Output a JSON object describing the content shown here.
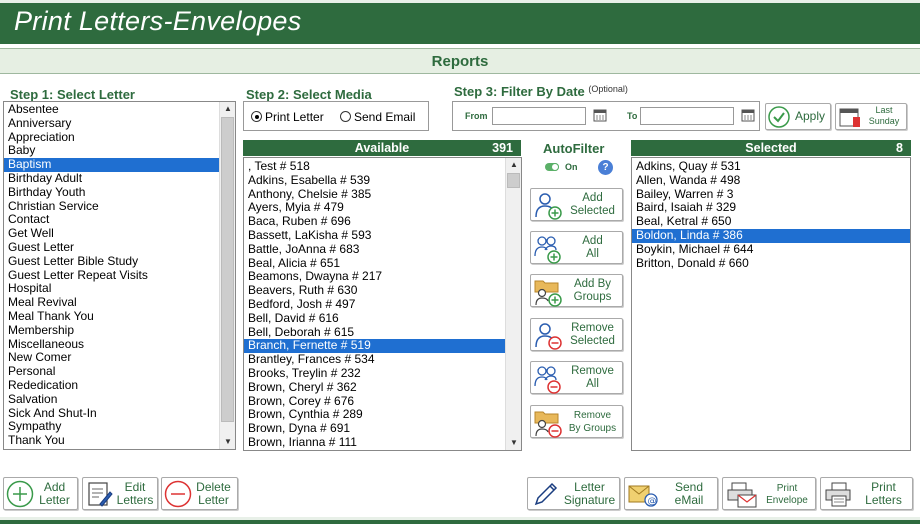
{
  "app": {
    "title": "Print Letters-Envelopes",
    "section": "Reports"
  },
  "steps": {
    "step1": "Step 1: Select Letter",
    "step2": "Step 2: Select Media",
    "step3": "Step 3: Filter By Date",
    "step3_optional": "(Optional)"
  },
  "letters": [
    "Absentee",
    "Anniversary",
    "Appreciation",
    "Baby",
    "Baptism",
    "Birthday Adult",
    "Birthday Youth",
    "Christian Service",
    "Contact",
    "Get Well",
    "Guest Letter",
    "Guest Letter Bible Study",
    "Guest Letter Repeat Visits",
    "Hospital",
    "Meal Revival",
    "Meal Thank You",
    "Membership",
    "Miscellaneous",
    "New Comer",
    "Personal",
    "Rededication",
    "Salvation",
    "Sick And Shut-In",
    "Sympathy",
    "Thank You"
  ],
  "selected_letter": "Baptism",
  "media": {
    "print_letter": "Print Letter",
    "send_email": "Send Email",
    "selected": "print_letter"
  },
  "filter": {
    "from_label": "From",
    "to_label": "To",
    "from_value": "",
    "to_value": "",
    "apply_label": "Apply",
    "last_sunday_line1": "Last",
    "last_sunday_line2": "Sunday"
  },
  "available": {
    "header": "Available",
    "count": "391",
    "items": [
      ", Test # 518",
      "Adkins, Esabella # 539",
      "Anthony, Chelsie # 385",
      "Ayers, Myia # 479",
      "Baca, Ruben # 696",
      "Bassett, LaKisha # 593",
      "Battle, JoAnna # 683",
      "Beal, Alicia # 651",
      "Beamons, Dwayna # 217",
      "Beavers, Ruth # 630",
      "Bedford, Josh # 497",
      "Bell, David # 616",
      "Bell, Deborah # 615",
      "Branch, Fernette # 519",
      "Brantley, Frances # 534",
      "Brooks, Treylin # 232",
      "Brown, Cheryl # 362",
      "Brown, Corey # 676",
      "Brown, Cynthia # 289",
      "Brown, Dyna # 691",
      "Brown, Irianna # 111"
    ],
    "selected_item": "Branch, Fernette # 519"
  },
  "autofilter": {
    "title": "AutoFilter",
    "toggle_label": "On",
    "help": "?"
  },
  "actions": {
    "add_selected": [
      "Add",
      "Selected"
    ],
    "add_all": [
      "Add",
      "All"
    ],
    "add_by_groups": [
      "Add By",
      "Groups"
    ],
    "remove_selected": [
      "Remove",
      "Selected"
    ],
    "remove_all": [
      "Remove",
      "All"
    ],
    "remove_by_groups": [
      "Remove",
      "By Groups"
    ]
  },
  "selected": {
    "header": "Selected",
    "count": "8",
    "items": [
      "Adkins, Quay # 531",
      "Allen, Wanda # 498",
      "Bailey, Warren # 3",
      "Baird, Isaiah # 329",
      "Beal, Ketral # 650",
      "Boldon, Linda # 386",
      "Boykin, Michael # 644",
      "Britton, Donald # 660"
    ],
    "selected_item": "Boldon, Linda # 386"
  },
  "bottom": {
    "add_letter": [
      "Add",
      "Letter"
    ],
    "edit_letters": [
      "Edit",
      "Letters"
    ],
    "delete_letter": [
      "Delete",
      "Letter"
    ],
    "letter_signature": [
      "Letter",
      "Signature"
    ],
    "send_email": [
      "Send",
      "eMail"
    ],
    "print_envelope": [
      "Print",
      "Envelope"
    ],
    "print_letters": [
      "Print",
      "Letters"
    ]
  },
  "colors": {
    "brand": "#2e6b3e",
    "selection": "#1f6fd1"
  }
}
